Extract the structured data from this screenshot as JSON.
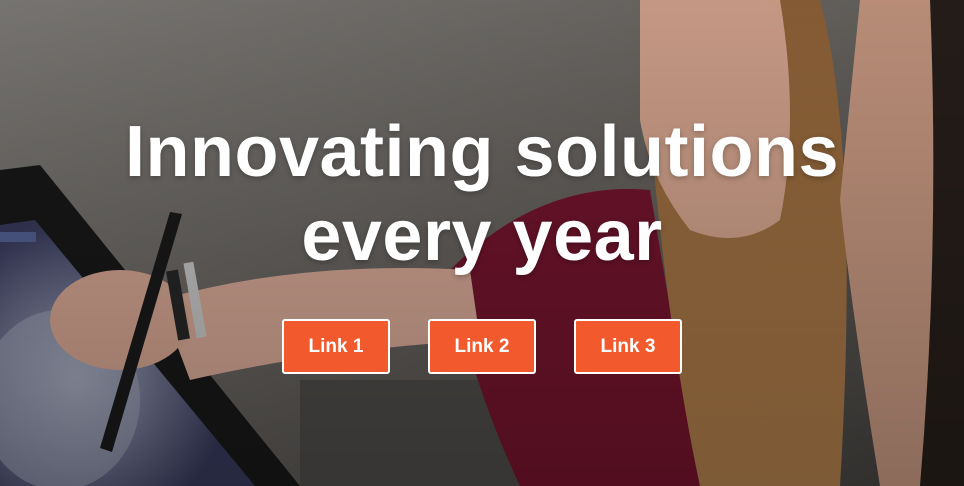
{
  "hero": {
    "title_line1": "Innovating solutions",
    "title_line2": "every year",
    "button_color": "#f2592d",
    "links": [
      {
        "label": "Link 1"
      },
      {
        "label": "Link 2"
      },
      {
        "label": "Link 3"
      }
    ]
  }
}
